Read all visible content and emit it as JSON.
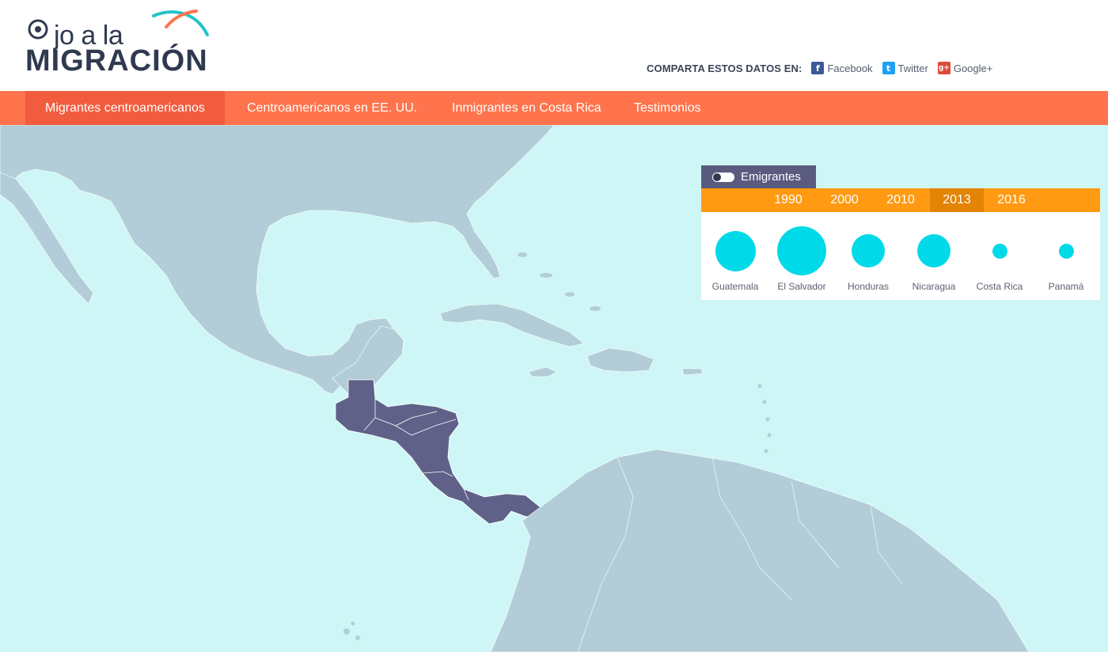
{
  "header": {
    "logo": {
      "line1": "jo a la",
      "line2": "MIGRACIÓN"
    },
    "share": {
      "label": "COMPARTA ESTOS DATOS EN:",
      "items": [
        {
          "name": "Facebook",
          "icon": "facebook-icon",
          "icon_glyph": "f",
          "color": "#3b5998"
        },
        {
          "name": "Twitter",
          "icon": "twitter-icon",
          "icon_glyph": "t",
          "color": "#1da1f2"
        },
        {
          "name": "Google+",
          "icon": "google-plus-icon",
          "icon_glyph": "g+",
          "color": "#dd4b39"
        }
      ]
    }
  },
  "nav": {
    "items": [
      {
        "label": "Migrantes centroamericanos",
        "active": true
      },
      {
        "label": "Centroamericanos en EE. UU.",
        "active": false
      },
      {
        "label": "Inmigrantes en Costa Rica",
        "active": false
      },
      {
        "label": "Testimonios",
        "active": false
      }
    ]
  },
  "panel": {
    "toggle_label": "Emigrantes",
    "years": [
      "1990",
      "2000",
      "2010",
      "2013",
      "2016"
    ],
    "selected_year": "2013",
    "countries": [
      {
        "name": "Guatemala",
        "relative_size": 0.83
      },
      {
        "name": "El Salvador",
        "relative_size": 1.0
      },
      {
        "name": "Honduras",
        "relative_size": 0.68
      },
      {
        "name": "Nicaragua",
        "relative_size": 0.68
      },
      {
        "name": "Costa Rica",
        "relative_size": 0.3
      },
      {
        "name": "Panamá",
        "relative_size": 0.3
      }
    ]
  },
  "colors": {
    "ocean": "#cff6f6",
    "land": "#b3cdd8",
    "highlight": "#5f6189",
    "nav": "#ff744c",
    "nav_active": "#f25c3e",
    "years_bar": "#ff9a12",
    "years_active": "#e38405",
    "bubble": "#00d9e8"
  }
}
